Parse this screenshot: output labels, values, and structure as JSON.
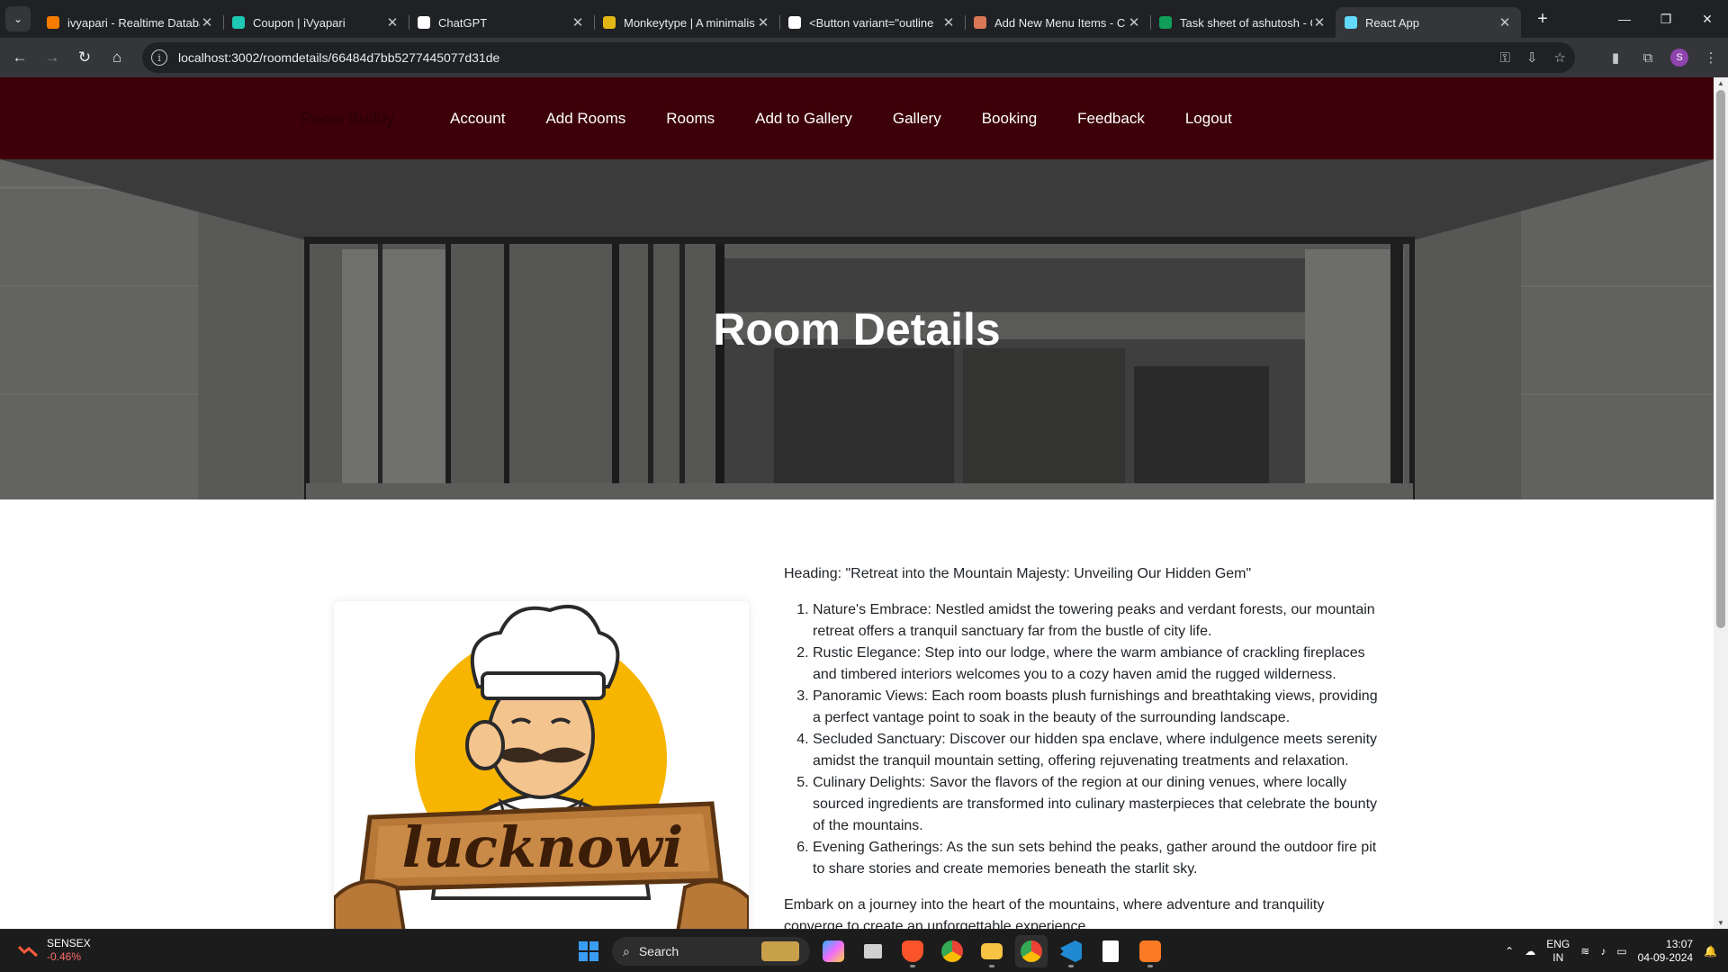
{
  "browser": {
    "tabs": [
      {
        "title": "ivyapari - Realtime Databa",
        "icon": "firebase-icon",
        "color": "#f57c00"
      },
      {
        "title": "Coupon | iVyapari",
        "icon": "ivyapari-icon",
        "color": "#1ec8b4"
      },
      {
        "title": "ChatGPT",
        "icon": "chatgpt-icon",
        "color": "#ffffff"
      },
      {
        "title": "Monkeytype | A minimalis",
        "icon": "monkeytype-icon",
        "color": "#e2b714"
      },
      {
        "title": "<Button variant=\"outline",
        "icon": "shadcn-icon",
        "color": "#ffffff"
      },
      {
        "title": "Add New Menu Items - C",
        "icon": "claude-icon",
        "color": "#d97757"
      },
      {
        "title": "Task sheet of ashutosh - G",
        "icon": "sheets-icon",
        "color": "#0f9d58"
      },
      {
        "title": "React App",
        "icon": "react-icon",
        "color": "#61dafb"
      }
    ],
    "url": "localhost:3002/roomdetails/66484d7bb5277445077d31de",
    "profile_initial": "S"
  },
  "site": {
    "brand": "Room Buddy",
    "nav": [
      "Account",
      "Add Rooms",
      "Rooms",
      "Add to Gallery",
      "Gallery",
      "Booking",
      "Feedback",
      "Logout"
    ],
    "hero_title": "Room Details",
    "room_image_text": "lucknowi",
    "room_image_icon": "chef-logo-image",
    "description": {
      "heading": "Heading: \"Retreat into the Mountain Majesty: Unveiling Our Hidden Gem\"",
      "items": [
        "Nature's Embrace: Nestled amidst the towering peaks and verdant forests, our mountain retreat offers a tranquil sanctuary far from the bustle of city life.",
        "Rustic Elegance: Step into our lodge, where the warm ambiance of crackling fireplaces and timbered interiors welcomes you to a cozy haven amid the rugged wilderness.",
        "Panoramic Views: Each room boasts plush furnishings and breathtaking views, providing a perfect vantage point to soak in the beauty of the surrounding landscape.",
        "Secluded Sanctuary: Discover our hidden spa enclave, where indulgence meets serenity amidst the tranquil mountain setting, offering rejuvenating treatments and relaxation.",
        "Culinary Delights: Savor the flavors of the region at our dining venues, where locally sourced ingredients are transformed into culinary masterpieces that celebrate the bounty of the mountains.",
        "Evening Gatherings: As the sun sets behind the peaks, gather around the outdoor fire pit to share stories and create memories beneath the starlit sky."
      ],
      "closing": "Embark on a journey into the heart of the mountains, where adventure and tranquility converge to create an unforgettable experience."
    }
  },
  "taskbar": {
    "widget_title": "SENSEX",
    "widget_value": "-0.46%",
    "search_placeholder": "Search",
    "lang_top": "ENG",
    "lang_bottom": "IN",
    "time": "13:07",
    "date": "04-09-2024"
  }
}
